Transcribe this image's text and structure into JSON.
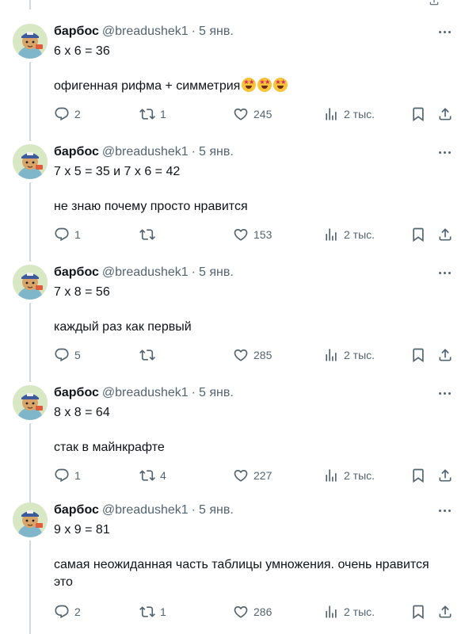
{
  "author": {
    "name": "барбос",
    "handle": "@breadushek1",
    "separator": "·",
    "date": "5 янв."
  },
  "tweets": [
    {
      "line1": "6 x 6 = 36",
      "line2": "офигенная рифма + симметрия",
      "emoji": [
        "star-struck-emoji",
        "star-struck-emoji",
        "star-struck-emoji"
      ],
      "replies": "2",
      "retweets": "1",
      "likes": "245",
      "views": "2 тыс."
    },
    {
      "line1": "7 x 5 = 35 и 7 x 6 = 42",
      "line2": "не знаю почему просто нравится",
      "replies": "1",
      "retweets": "",
      "likes": "153",
      "views": "2 тыс."
    },
    {
      "line1": "7 x 8 = 56",
      "line2": "каждый раз как первый",
      "replies": "5",
      "retweets": "",
      "likes": "285",
      "views": "2 тыс."
    },
    {
      "line1": "8 x 8 = 64",
      "line2": "стак в майнкрафте",
      "replies": "1",
      "retweets": "4",
      "likes": "227",
      "views": "2 тыс."
    },
    {
      "line1": "9 x 9 = 81",
      "line2": "самая неожиданная часть таблицы умножения. очень нравится",
      "line3": "это",
      "replies": "2",
      "retweets": "1",
      "likes": "286",
      "views": "2 тыс."
    }
  ],
  "icons": {
    "reply": "reply-icon",
    "retweet": "retweet-icon",
    "like": "heart-icon",
    "views": "views-icon",
    "bookmark": "bookmark-icon",
    "share": "share-icon",
    "more": "more-icon"
  },
  "colors": {
    "text": "#0f1419",
    "muted": "#536471",
    "thread": "#cfd9de"
  }
}
